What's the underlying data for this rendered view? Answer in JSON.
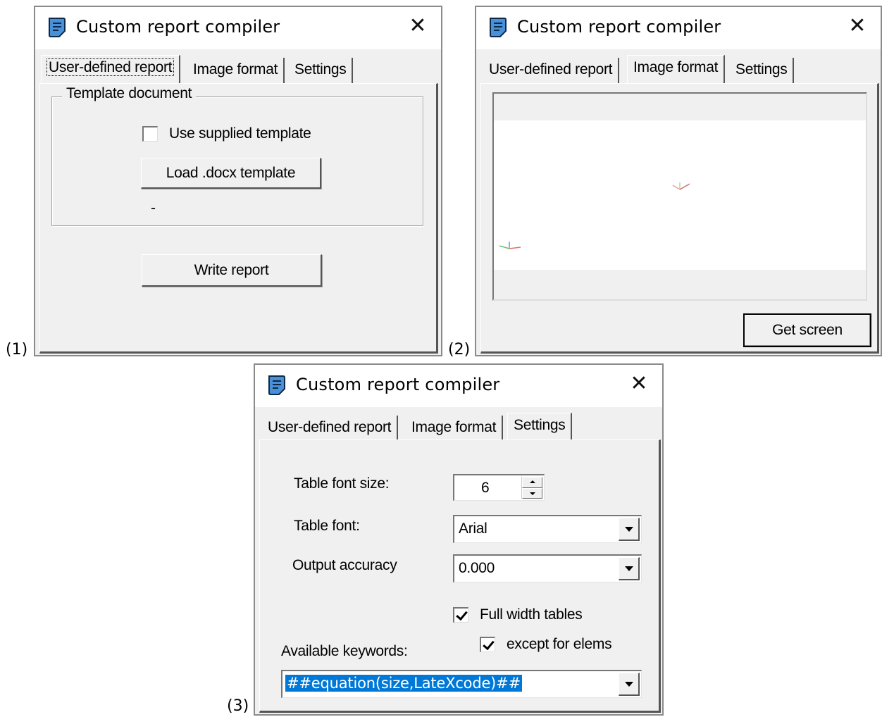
{
  "panels": [
    {
      "label": "(1)",
      "window": {
        "title": "Custom report compiler",
        "close_symbol": "✕",
        "tabs": [
          "User-defined report",
          "Image format",
          "Settings"
        ],
        "active_tab": 0,
        "template_group": {
          "title": "Template document",
          "use_template_label": "Use supplied template",
          "use_template_checked": false,
          "load_button": "Load .docx template",
          "template_path": "-"
        },
        "write_button": "Write report"
      }
    },
    {
      "label": "(2)",
      "window": {
        "title": "Custom report compiler",
        "close_symbol": "✕",
        "tabs": [
          "User-defined report",
          "Image format",
          "Settings"
        ],
        "active_tab": 1,
        "get_screen_button": "Get screen"
      }
    },
    {
      "label": "(3)",
      "window": {
        "title": "Custom report compiler",
        "close_symbol": "✕",
        "tabs": [
          "User-defined report",
          "Image format",
          "Settings"
        ],
        "active_tab": 2,
        "settings": {
          "table_font_size_label": "Table font size:",
          "table_font_size_value": "6",
          "table_font_label": "Table font:",
          "table_font_value": "Arial",
          "output_accuracy_label": "Output accuracy",
          "output_accuracy_value": "0.000",
          "full_width_label": "Full width tables",
          "full_width_checked": true,
          "except_elems_label": "except for elems",
          "except_elems_checked": true,
          "keywords_label": "Available keywords:",
          "keywords_value": "##equation(size,LateXcode)##"
        }
      }
    }
  ],
  "colors": {
    "window_bg": "#f0f0f0",
    "titlebar_bg": "#ffffff",
    "icon_blue": "#4a90d9",
    "selection_blue": "#0078d7"
  }
}
